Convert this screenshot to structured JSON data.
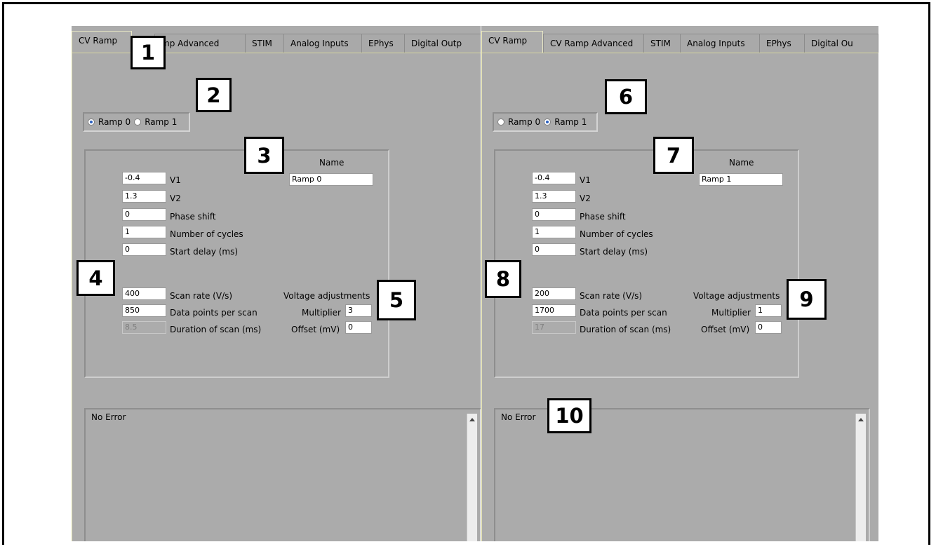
{
  "tabs": [
    "CV Ramp",
    "CV Ramp Advanced",
    "STIM",
    "Analog Inputs",
    "EPhys",
    "Digital Outputs"
  ],
  "left_tab_labels": [
    "CV Ramp",
    "mp Advanced",
    "STIM",
    "Analog Inputs",
    "EPhys",
    "Digital Outp"
  ],
  "right_tab_labels": [
    "CV Ramp",
    "CV Ramp Advanced",
    "STIM",
    "Analog Inputs",
    "EPhys",
    "Digital Ou"
  ],
  "radio": {
    "ramp0": "Ramp 0",
    "ramp1": "Ramp 1"
  },
  "labels": {
    "name": "Name",
    "v1": "V1",
    "v2": "V2",
    "phase_shift": "Phase shift",
    "num_cycles": "Number of cycles",
    "start_delay": "Start delay (ms)",
    "scan_rate": "Scan rate (V/s)",
    "data_points": "Data points per scan",
    "duration": "Duration of scan (ms)",
    "voltage_adj": "Voltage adjustments",
    "multiplier": "Multiplier",
    "offset": "Offset (mV)"
  },
  "left": {
    "selected_ramp": "Ramp 0",
    "name": "Ramp 0",
    "v1": "-0.4",
    "v2": "1.3",
    "phase_shift": "0",
    "num_cycles": "1",
    "start_delay": "0",
    "scan_rate": "400",
    "data_points": "850",
    "duration": "8.5",
    "multiplier": "3",
    "offset": "0",
    "error": "No Error"
  },
  "right": {
    "selected_ramp": "Ramp 1",
    "name": "Ramp 1",
    "v1": "-0.4",
    "v2": "1.3",
    "phase_shift": "0",
    "num_cycles": "1",
    "start_delay": "0",
    "scan_rate": "200",
    "data_points": "1700",
    "duration": "17",
    "multiplier": "1",
    "offset": "0",
    "error": "No Error"
  },
  "callouts": [
    "1",
    "2",
    "3",
    "4",
    "5",
    "6",
    "7",
    "8",
    "9",
    "10"
  ]
}
